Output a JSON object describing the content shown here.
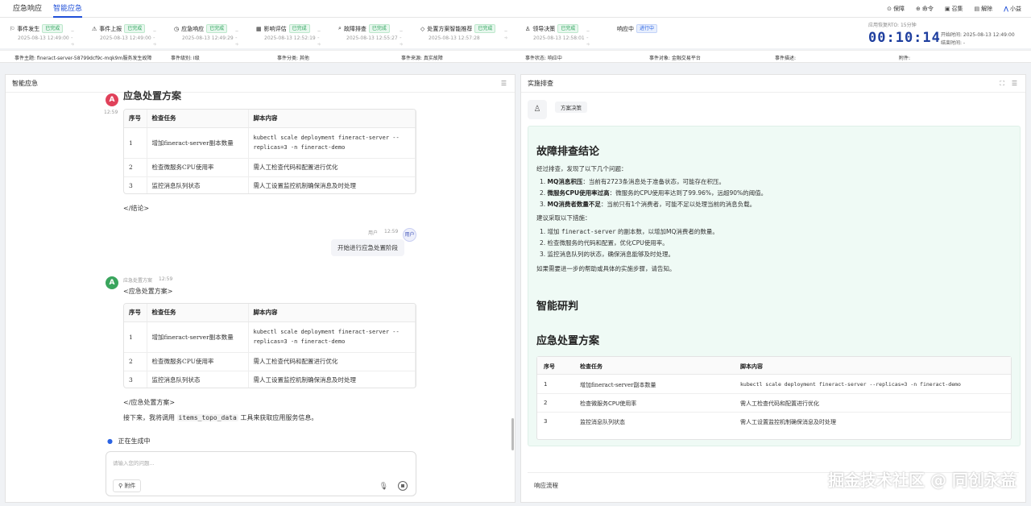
{
  "topbar": {
    "tabs": [
      "应急响应",
      "智能应急"
    ],
    "right_items": [
      "保障",
      "命令",
      "召集",
      "解除",
      "小益"
    ]
  },
  "steps": [
    {
      "name": "事件发生",
      "status": "已完成",
      "time": "2025-08-13 12:49:00"
    },
    {
      "name": "事件上报",
      "status": "已完成",
      "time": "2025-08-13 12:49:00"
    },
    {
      "name": "应急响应",
      "status": "已完成",
      "time": "2025-08-13 12:49:29"
    },
    {
      "name": "影响评估",
      "status": "已完成",
      "time": "2025-08-13 12:52:19"
    },
    {
      "name": "故障排查",
      "status": "已完成",
      "time": "2025-08-13 12:55:27"
    },
    {
      "name": "处置方案智能推荐",
      "status": "已完成",
      "time": "2025-08-13 12:57:28"
    },
    {
      "name": "领导决策",
      "status": "已完成",
      "time": "2025-08-13 12:58:01"
    },
    {
      "name": "响应中",
      "status": "进行中",
      "time": ""
    }
  ],
  "timer": {
    "rto_label": "应用恢复RTO: 15分钟",
    "clock": "00:10:14",
    "start_label": "开始时间: 2025-08-13 12:49:00",
    "end_label": "结束时间: -"
  },
  "info": [
    "事件主题: fineract-server-58799dcf9c-mqk9m服务发生故障",
    "事件级别: I级",
    "事件分类: 其他",
    "事件来源: 真实故障",
    "事件状态: 响应中",
    "事件对象: 金融交易平台",
    "事件描述:",
    "附件:"
  ],
  "left_panel": {
    "title": "智能应急",
    "top_heading": "应急处置方案",
    "top_time": "12:59",
    "table_headers": [
      "序号",
      "检查任务",
      "脚本内容"
    ],
    "table_rows": [
      [
        "1",
        "增加fineract-server副本数量",
        "kubectl scale deployment fineract-server --replicas=3 -n fineract-demo"
      ],
      [
        "2",
        "检查微服务CPU使用率",
        "需人工检查代码和配置进行优化"
      ],
      [
        "3",
        "监控消息队列状态",
        "需人工设置监控机制确保消息及时处理"
      ]
    ],
    "end_conclusion": "</结论>",
    "user_name": "用户",
    "user_time": "12:59",
    "user_avatar": "用户",
    "user_message": "开始进行应急处置阶段",
    "bot_name": "应急处置方案",
    "bot_time": "12:59",
    "bot_open_tag": "<应急处置方案>",
    "bot_close_tag": "</应急处置方案>",
    "next_text_prefix": "接下来，我将调用",
    "next_text_code": "items_topo_data",
    "next_text_suffix": "工具来获取应用服务信息。",
    "generating": "正在生成中",
    "input_placeholder": "请输入您的问题...",
    "attach_label": "附件"
  },
  "right_panel": {
    "title": "实施排查",
    "decision_tag": "方案决策",
    "h_conclusion": "故障排查结论",
    "intro": "经过排查，发现了以下几个问题：",
    "issues": [
      {
        "title": "MQ消息积压",
        "desc": "：当前有2723条消息处于准备状态，可能存在积压。"
      },
      {
        "title": "微服务CPU使用率过高",
        "desc": "：微服务的CPU使用率达到了99.96%，远超90%的阈值。"
      },
      {
        "title": "MQ消费者数量不足",
        "desc": "：当前只有1个消费者，可能不足以处理当前的消息负载。"
      }
    ],
    "suggest_intro": "建议采取以下措施：",
    "suggestions": [
      {
        "pre": "增加 ",
        "code": "fineract-server",
        "post": " 的副本数，以增加MQ消费者的数量。"
      },
      {
        "pre": "检查微服务的代码和配置，优化CPU使用率。",
        "code": "",
        "post": ""
      },
      {
        "pre": "监控消息队列的状态，确保消息能够及时处理。",
        "code": "",
        "post": ""
      }
    ],
    "closing": "如果需要进一步的帮助或具体的实施步骤，请告知。",
    "h_research": "智能研判",
    "h_plan": "应急处置方案",
    "table_headers": [
      "序号",
      "检查任务",
      "脚本内容"
    ],
    "table_rows": [
      [
        "1",
        "增加fineract-server副本数量",
        "kubectl scale deployment fineract-server --replicas=3 -n fineract-demo"
      ],
      [
        "2",
        "检查微服务CPU使用率",
        "需人工检查代码和配置进行优化"
      ],
      [
        "3",
        "监控消息队列状态",
        "需人工设置监控机制确保消息及时处理"
      ]
    ],
    "footer": "响应流程"
  },
  "watermark": "掘金技术社区 @ 同创永益",
  "colors": {
    "accent": "#1f4fd8",
    "success": "#2aa35a",
    "report_bg": "#effaf5"
  }
}
